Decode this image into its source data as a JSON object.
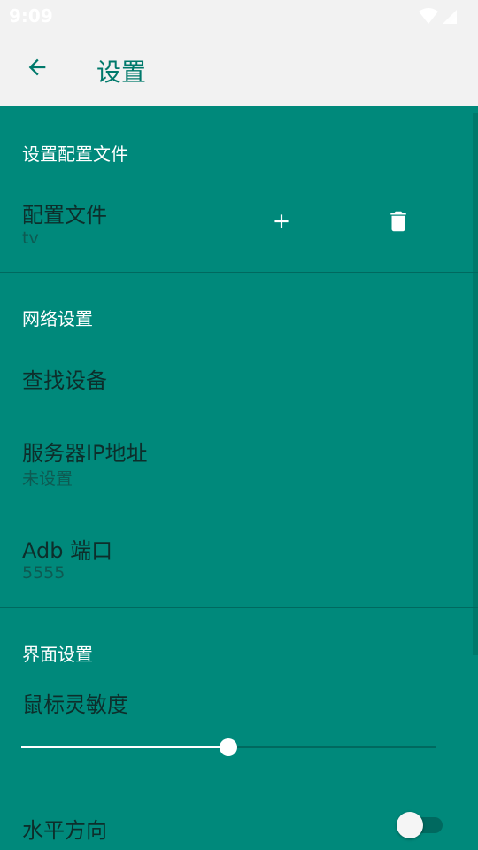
{
  "status": {
    "time": "9:09"
  },
  "appbar": {
    "title": "设置"
  },
  "sections": {
    "profile": {
      "header": "设置配置文件",
      "item_title": "配置文件",
      "item_value": "tv"
    },
    "network": {
      "header": "网络设置",
      "find_device": "查找设备",
      "server_ip_title": "服务器IP地址",
      "server_ip_value": "未设置",
      "adb_port_title": "Adb 端口",
      "adb_port_value": "5555"
    },
    "interface": {
      "header": "界面设置",
      "mouse_sensitivity": "鼠标灵敏度",
      "horizontal": "水平方向"
    }
  },
  "controls": {
    "mouse_sensitivity_level": 0.5,
    "horizontal_enabled": false
  },
  "icons": {
    "back": "arrow-left-icon",
    "add": "plus-icon",
    "delete": "trash-icon",
    "wifi": "wifi-icon",
    "signal": "signal-icon"
  },
  "colors": {
    "primary": "#00897b",
    "accent": "#00796b",
    "divider": "#00695f"
  }
}
